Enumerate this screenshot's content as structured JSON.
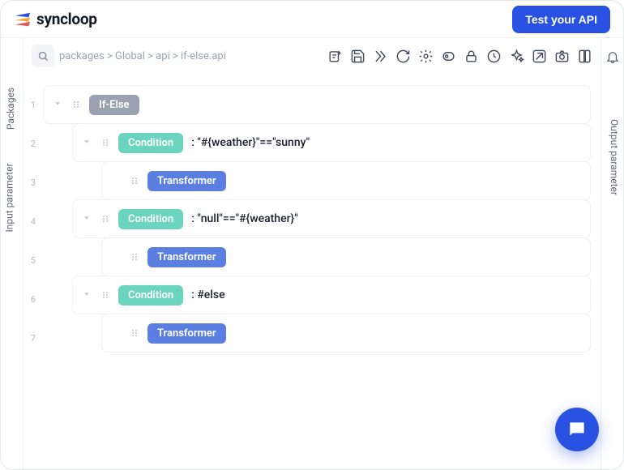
{
  "header": {
    "brand": "syncloop",
    "test_btn": "Test your API"
  },
  "rails": {
    "packages": "Packages",
    "input": "Input parameter",
    "output": "Output parameter"
  },
  "breadcrumb": "packages > Global > api > if-else.api",
  "chips": {
    "ifelse": "If-Else",
    "condition": "Condition",
    "transformer": "Transformer"
  },
  "rows": {
    "r2_text": ": \"#{weather}\"==\"sunny\"",
    "r4_text": ": \"null\"==\"#{weather}\"",
    "r6_text": ": #else"
  },
  "line_numbers": [
    "1",
    "2",
    "3",
    "4",
    "5",
    "6",
    "7"
  ],
  "icons": {
    "search": "search-icon",
    "bell": "bell-icon",
    "chat": "chat-icon"
  }
}
